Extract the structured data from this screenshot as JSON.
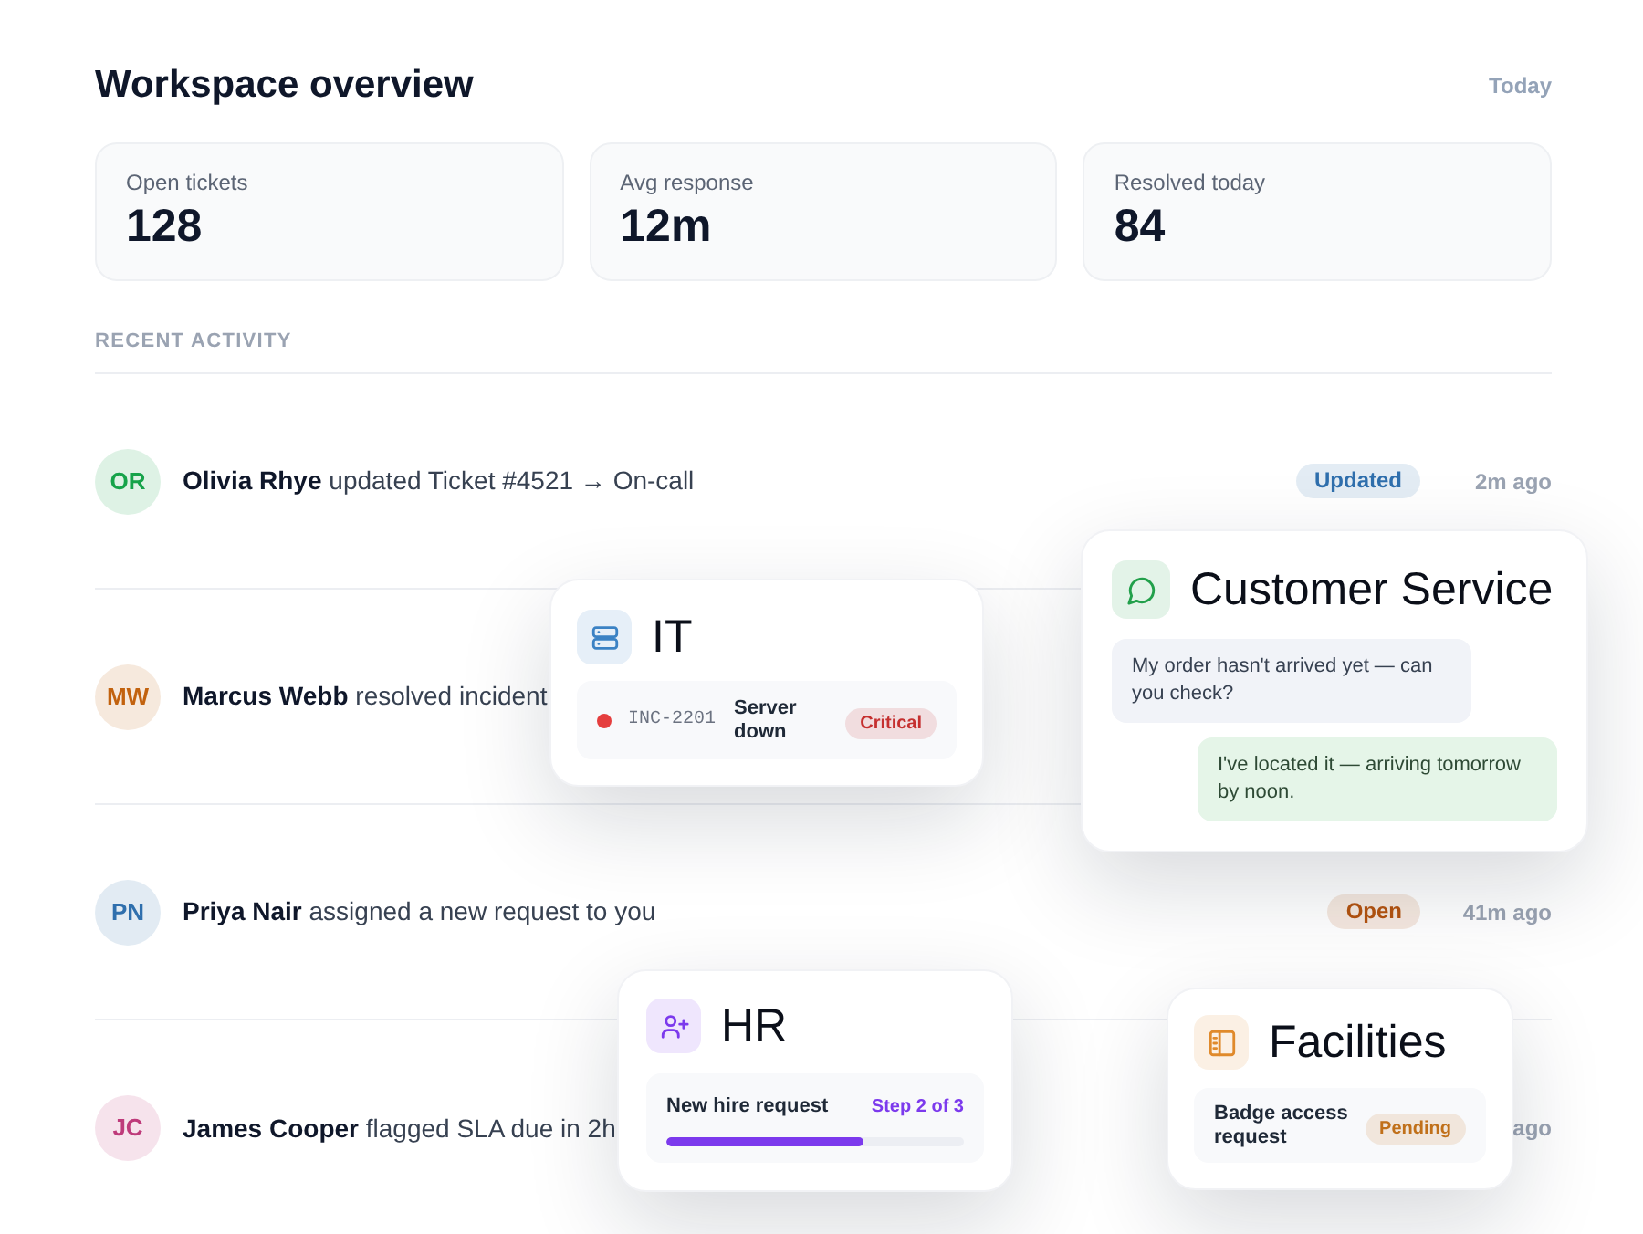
{
  "header": {
    "title": "Workspace overview",
    "period": "Today"
  },
  "stats": [
    {
      "label": "Open tickets",
      "value": "128"
    },
    {
      "label": "Avg response",
      "value": "12m"
    },
    {
      "label": "Resolved today",
      "value": "84"
    }
  ],
  "activity": {
    "heading": "RECENT ACTIVITY",
    "items": [
      {
        "initials": "OR",
        "color": "#16a34a",
        "text": "**Olivia Rhye** updated Ticket #4521 → On-call",
        "badge": {
          "label": "Updated",
          "color": "#2f6fad"
        },
        "time": "2m ago"
      },
      {
        "initials": "MW",
        "color": "#c2620e",
        "text": "**Marcus Webb** resolved incident"
      },
      {
        "initials": "PN",
        "color": "#2f6fad",
        "text": "**Priya Nair** assigned a new request to you",
        "badge": {
          "label": "Open",
          "color": "#b4530f"
        },
        "time": "41m ago"
      },
      {
        "initials": "JC",
        "color": "#be3a7a",
        "text": "**James Cooper** flagged SLA due in 2h",
        "time": "ago"
      }
    ]
  },
  "cards": [
    {
      "kind": "ticket",
      "title": "IT",
      "color": "#3b82c4",
      "ticket": {
        "id": "INC-2201",
        "title": "Server down",
        "badge": {
          "label": "Critical",
          "color": "#c53030"
        }
      }
    },
    {
      "kind": "chat",
      "title": "Customer Service",
      "color": "#22a04b",
      "messages": [
        {
          "kind": "incoming",
          "text": "My order hasn't arrived yet — can you check?"
        },
        {
          "kind": "outgoing",
          "text": "I've located it — arriving tomorrow by noon."
        }
      ]
    },
    {
      "kind": "progress",
      "title": "HR",
      "color": "#7c3aed",
      "task": {
        "label": "New hire request",
        "step": "Step 2 of 3",
        "level": 0.66
      }
    },
    {
      "kind": "request",
      "title": "Facilities",
      "color": "#e08a2b",
      "request": {
        "label": "Badge access request",
        "badge": {
          "label": "Pending",
          "color": "#c0701a"
        }
      }
    }
  ]
}
